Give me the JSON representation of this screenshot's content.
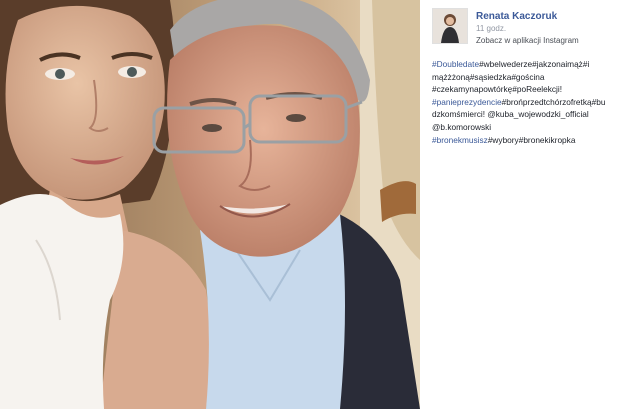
{
  "post": {
    "author": "Renata Kaczoruk",
    "time": "11 godz.",
    "instagram_link": "Zobacz w aplikacji Instagram",
    "caption_lines": [
      [
        {
          "t": "#Doubledate",
          "tag": true
        },
        {
          "t": "#wbelwederze#jakzonaimąż#i",
          "tag": false
        }
      ],
      [
        {
          "t": "mążżżoną#sąsiedzka#gościna",
          "tag": false
        }
      ],
      [
        {
          "t": "#czekamynapowtórkę#poReelekcji!",
          "tag": false
        }
      ],
      [
        {
          "t": "#panieprezydencie",
          "tag": true
        },
        {
          "t": "#brońprzedtchórzofretką#bu",
          "tag": false
        }
      ],
      [
        {
          "t": "dzkomśmierci! @kuba_wojewodzki_official",
          "tag": false
        }
      ],
      [
        {
          "t": "@b.komorowski",
          "tag": false
        }
      ],
      [
        {
          "t": "#bronekmusisz",
          "tag": true
        },
        {
          "t": "#wybory#bronekikropka",
          "tag": false
        }
      ]
    ]
  },
  "colors": {
    "link": "#3b5998",
    "text": "#1d2129",
    "meta": "#9197a3"
  }
}
